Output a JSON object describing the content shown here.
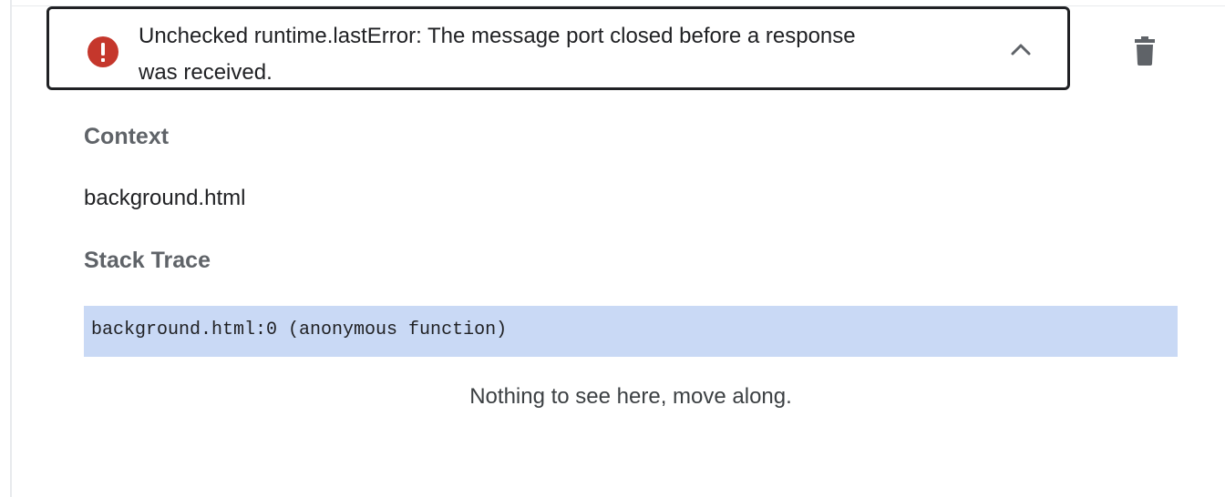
{
  "error": {
    "message": "Unchecked runtime.lastError: The message port closed before a response\nwas received.",
    "icon": "error-exclamation-icon",
    "icon_color": "#c5372c",
    "expand_icon": "chevron-up-icon",
    "delete_icon": "trash-icon"
  },
  "context": {
    "heading": "Context",
    "value": "background.html"
  },
  "stack_trace": {
    "heading": "Stack Trace",
    "frames": [
      "background.html:0 (anonymous function)"
    ],
    "highlight_color": "#c9d9f5"
  },
  "empty_message": "Nothing to see here, move along."
}
